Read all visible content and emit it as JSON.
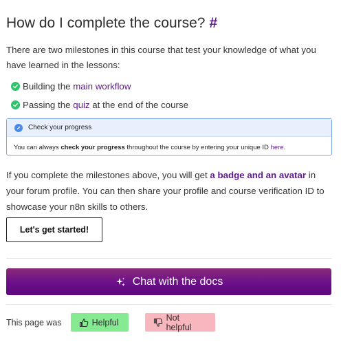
{
  "heading": {
    "title": "How do I complete the course?",
    "anchor": "#"
  },
  "intro": "There are two milestones in this course that test your knowledge of what you have learned in the lessons:",
  "milestones": [
    {
      "prefix": "Building the ",
      "link": "main workflow",
      "suffix": ""
    },
    {
      "prefix": "Passing the ",
      "link": "quiz",
      "suffix": " at the end of the course"
    }
  ],
  "callout": {
    "title": "Check your progress",
    "body_prefix": "You can always ",
    "body_bold": "check your progress",
    "body_middle": " throughout the course by entering your unique ID ",
    "body_link": "here",
    "body_suffix": "."
  },
  "after": {
    "prefix": "If you complete the milestones above, you will get ",
    "bold": "a badge and an avatar",
    "suffix": " in your forum profile. You can then share your profile and course verification ID to showcase your n8n skills to others."
  },
  "start_button": "Let's get started!",
  "chat_button": "Chat with the docs",
  "feedback": {
    "label": "This page was",
    "helpful": "Helpful",
    "not_helpful": "Not helpful"
  },
  "colors": {
    "accent": "#5b1a8c",
    "check": "#2fc36b",
    "info": "#4c8be8",
    "helpful_bg": "#86ea92",
    "not_helpful_bg": "#f8b6be"
  },
  "icons": {
    "milestone": "check-circle-icon",
    "callout": "pencil-circle-icon",
    "chat": "sparkles-icon",
    "helpful": "thumbs-up-icon",
    "not_helpful": "thumbs-down-icon"
  }
}
